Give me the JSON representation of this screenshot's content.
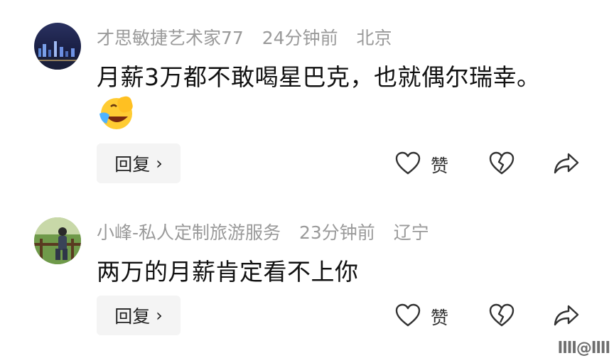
{
  "comments": [
    {
      "username": "才思敏捷艺术家77",
      "time": "24分钟前",
      "location": "北京",
      "text": "月薪3万都不敢喝星巴克，也就偶尔瑞幸。",
      "emoji": "laughing-crying-emoji",
      "reply_label": "回复",
      "like_label": "赞"
    },
    {
      "username": "小峰-私人定制旅游服务",
      "time": "23分钟前",
      "location": "辽宁",
      "text": "两万的月薪肯定看不上你",
      "reply_label": "回复",
      "like_label": "赞"
    }
  ],
  "icons": {
    "reply_chevron": "›",
    "like": "heart-outline-icon",
    "dislike": "broken-heart-icon",
    "share": "share-arrow-icon"
  },
  "watermark": "llll@llll"
}
